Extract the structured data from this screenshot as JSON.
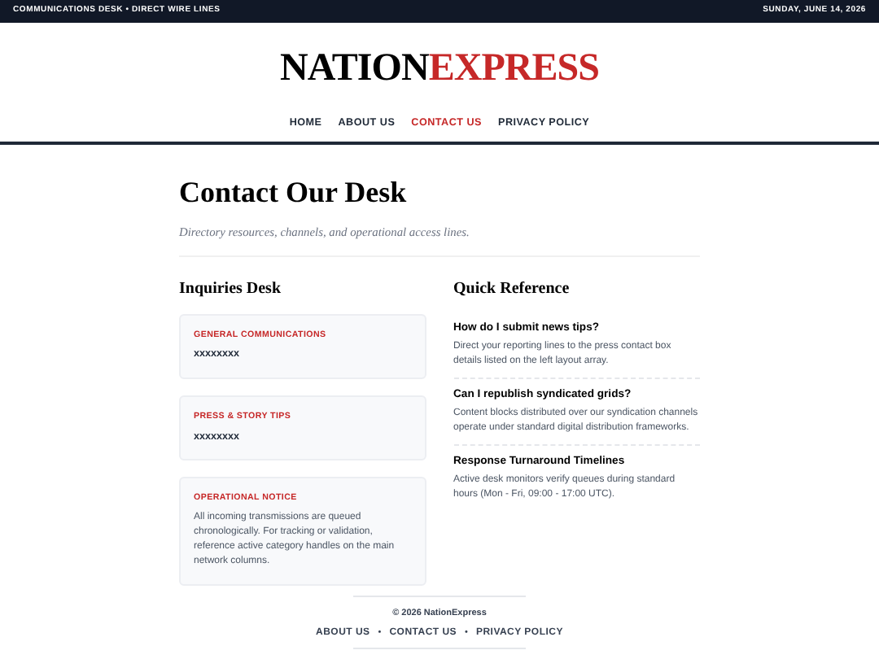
{
  "top_bar": {
    "left": "COMMUNICATIONS DESK • DIRECT WIRE LINES",
    "date": "SUNDAY, JUNE 14, 2026"
  },
  "logo": {
    "first": "NATION",
    "second": "EXPRESS"
  },
  "nav": [
    {
      "label": "HOME",
      "selected": false
    },
    {
      "label": "ABOUT US",
      "selected": false
    },
    {
      "label": "CONTACT US",
      "selected": true
    },
    {
      "label": "PRIVACY POLICY",
      "selected": false
    }
  ],
  "page": {
    "title": "Contact Our Desk",
    "subtitle": "Directory resources, channels, and operational access lines."
  },
  "inquiries": {
    "heading": "Inquiries Desk",
    "cards": [
      {
        "kind": "contact",
        "label": "GENERAL COMMUNICATIONS",
        "value": "xxxxxxxx"
      },
      {
        "kind": "contact",
        "label": "PRESS & STORY TIPS",
        "value": "xxxxxxxx"
      },
      {
        "kind": "notice",
        "label": "OPERATIONAL NOTICE",
        "value": "All incoming transmissions are queued chronologically. For tracking or validation, reference active category handles on the main network columns."
      }
    ]
  },
  "quick_reference": {
    "heading": "Quick Reference",
    "items": [
      {
        "question": "How do I submit news tips?",
        "answer": "Direct your reporting lines to the press contact box details listed on the left layout array."
      },
      {
        "question": "Can I republish syndicated grids?",
        "answer": "Content blocks distributed over our syndication channels operate under standard digital distribution frameworks."
      },
      {
        "question": "Response Turnaround Timelines",
        "answer": "Active desk monitors verify queues during standard hours (Mon - Fri, 09:00 - 17:00 UTC)."
      }
    ]
  },
  "footer": {
    "copyright": "© 2026 NationExpress",
    "separator": "•",
    "links": [
      "ABOUT US",
      "CONTACT US",
      "PRIVACY POLICY"
    ]
  }
}
